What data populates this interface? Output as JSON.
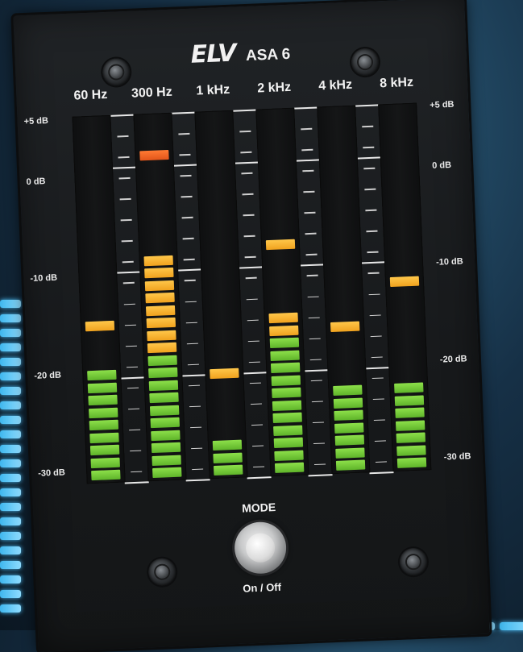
{
  "device": {
    "brand": "ELV",
    "model": "ASA 6"
  },
  "bands": [
    {
      "label": "60 Hz"
    },
    {
      "label": "300 Hz"
    },
    {
      "label": "1 kHz"
    },
    {
      "label": "2 kHz"
    },
    {
      "label": "4 kHz"
    },
    {
      "label": "8 kHz"
    }
  ],
  "db_scale_left": [
    "+5 dB",
    "0 dB",
    "-10 dB",
    "-20 dB",
    "-30 dB"
  ],
  "db_scale_right": [
    "+5 dB",
    "0 dB",
    "-10 dB",
    "-20 dB",
    "-30 dB"
  ],
  "meter_levels": [
    {
      "band": "60 Hz",
      "green": 9,
      "amber": 0,
      "peak_db": -15
    },
    {
      "band": "300 Hz",
      "green": 10,
      "amber": 8,
      "peak_db": 1
    },
    {
      "band": "1 kHz",
      "green": 3,
      "amber": 0,
      "peak_db": -20
    },
    {
      "band": "2 kHz",
      "green": 11,
      "amber": 2,
      "peak_db": -8
    },
    {
      "band": "4 kHz",
      "green": 7,
      "amber": 0,
      "peak_db": -16
    },
    {
      "band": "8 kHz",
      "green": 7,
      "amber": 0,
      "peak_db": -12
    }
  ],
  "controls": {
    "mode_label": "MODE",
    "onoff_label": "On / Off"
  },
  "colors": {
    "green_segment": "#6ec533",
    "amber_segment": "#f6b12f",
    "red_segment": "#ef6423",
    "panel": "#1b1d1f",
    "glow": "#3fb7ee"
  }
}
